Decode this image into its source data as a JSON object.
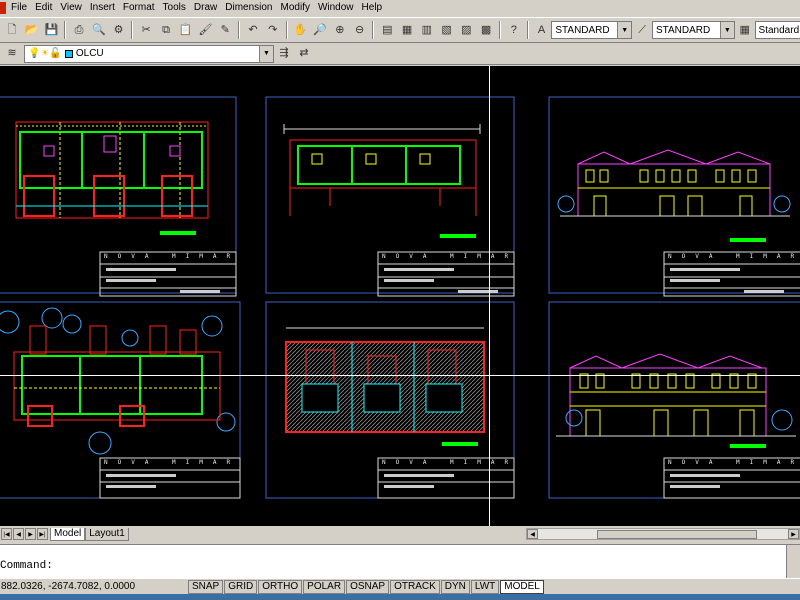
{
  "menubar": {
    "items": [
      "File",
      "Edit",
      "View",
      "Insert",
      "Format",
      "Tools",
      "Draw",
      "Dimension",
      "Modify",
      "Window",
      "Help"
    ]
  },
  "toolbar1": {
    "text_style": "STANDARD",
    "dim_style": "STANDARD",
    "table_style": "Standard"
  },
  "toolbar2": {
    "layer": "OLCU"
  },
  "drawing": {
    "title_text": "NOVA MIMARLIK",
    "colors": {
      "background": "#000000",
      "sheet_frame": "#3d64c4",
      "walls_red": "#ff2020",
      "walls_green": "#00ff00",
      "text_yellow": "#ffff00",
      "trees_cyan": "#3ba8ff",
      "roof_magenta": "#ff40ff"
    }
  },
  "layout_tabs": {
    "tabs": [
      "Model",
      "Layout1"
    ],
    "active": "Model"
  },
  "command": {
    "prompt": "Command:"
  },
  "status": {
    "coords": "882.0326, -2674.7082, 0.0000",
    "toggles": [
      "SNAP",
      "GRID",
      "ORTHO",
      "POLAR",
      "OSNAP",
      "OTRACK",
      "DYN",
      "LWT",
      "MODEL"
    ]
  }
}
